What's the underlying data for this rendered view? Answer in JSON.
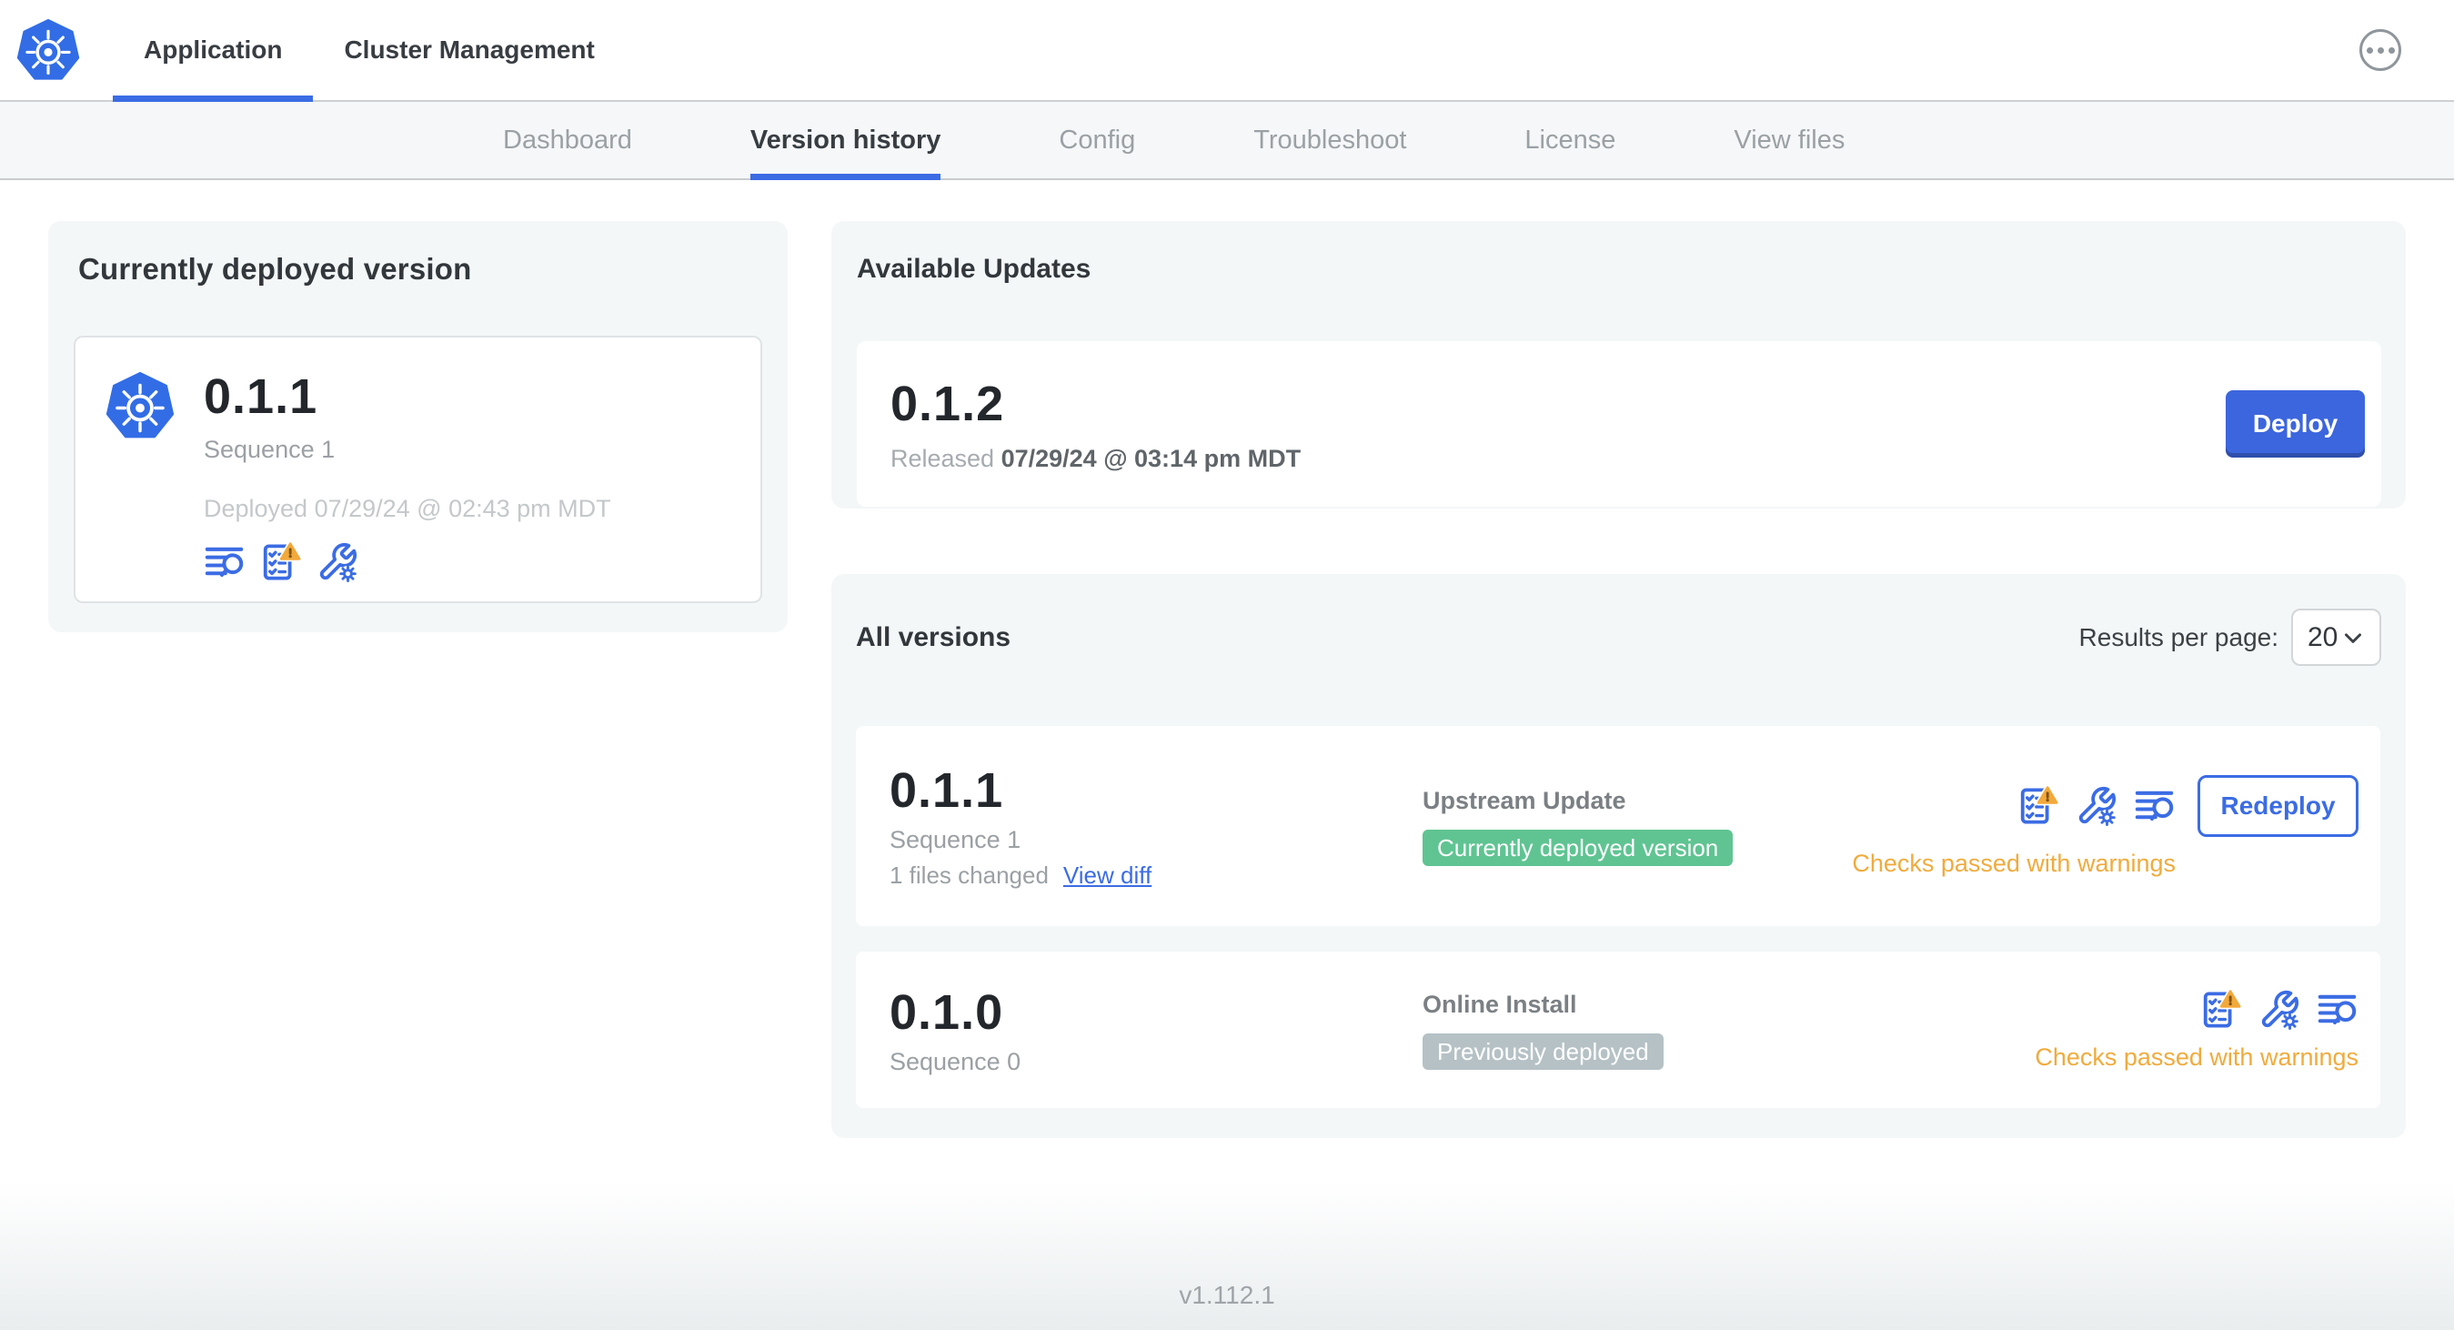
{
  "topnav": {
    "tabs": [
      {
        "label": "Application"
      },
      {
        "label": "Cluster Management"
      }
    ],
    "active_tab": "Application",
    "more_menu_icon": "ellipsis-icon"
  },
  "subnav": {
    "tabs": [
      "Dashboard",
      "Version history",
      "Config",
      "Troubleshoot",
      "License",
      "View files"
    ],
    "active_tab": "Version history"
  },
  "deployed_card": {
    "title": "Currently deployed version",
    "version": "0.1.1",
    "sequence": "Sequence 1",
    "deployed_at": "Deployed 07/29/24 @ 02:43 pm MDT",
    "icons": [
      "logs-icon",
      "preflight-checks-warning-icon",
      "config-icon"
    ]
  },
  "available_updates": {
    "title": "Available Updates",
    "version": "0.1.2",
    "released_label": "Released",
    "released_at": "07/29/24 @ 03:14 pm MDT",
    "deploy_button": "Deploy"
  },
  "all_versions": {
    "title": "All versions",
    "results_per_page_label": "Results per page:",
    "results_per_page_value": "20",
    "rows": [
      {
        "version": "0.1.1",
        "sequence": "Sequence 1",
        "files_changed": "1 files changed",
        "view_diff_label": "View diff",
        "source": "Upstream Update",
        "badge": "Currently deployed version",
        "badge_style": "green",
        "status": "Checks passed with warnings",
        "action_button": "Redeploy",
        "icons": [
          "preflight-checks-warning-icon",
          "config-icon",
          "logs-icon"
        ]
      },
      {
        "version": "0.1.0",
        "sequence": "Sequence 0",
        "source": "Online Install",
        "badge": "Previously deployed",
        "badge_style": "gray",
        "status": "Checks passed with warnings",
        "icons": [
          "preflight-checks-warning-icon",
          "config-icon",
          "logs-icon"
        ]
      }
    ]
  },
  "footer": {
    "version": "v1.112.1"
  },
  "colors": {
    "accent_blue": "#3b6ce4",
    "deploy_button_blue": "#3c66dd",
    "kubernetes_blue": "#326de6",
    "warning_orange": "#f0ab3d",
    "warning_triangle": "#f2a93b",
    "badge_green": "#5fc492",
    "badge_gray": "#b5c1c5",
    "card_background": "#f4f7f8",
    "subnav_background": "#f5f7f8"
  }
}
